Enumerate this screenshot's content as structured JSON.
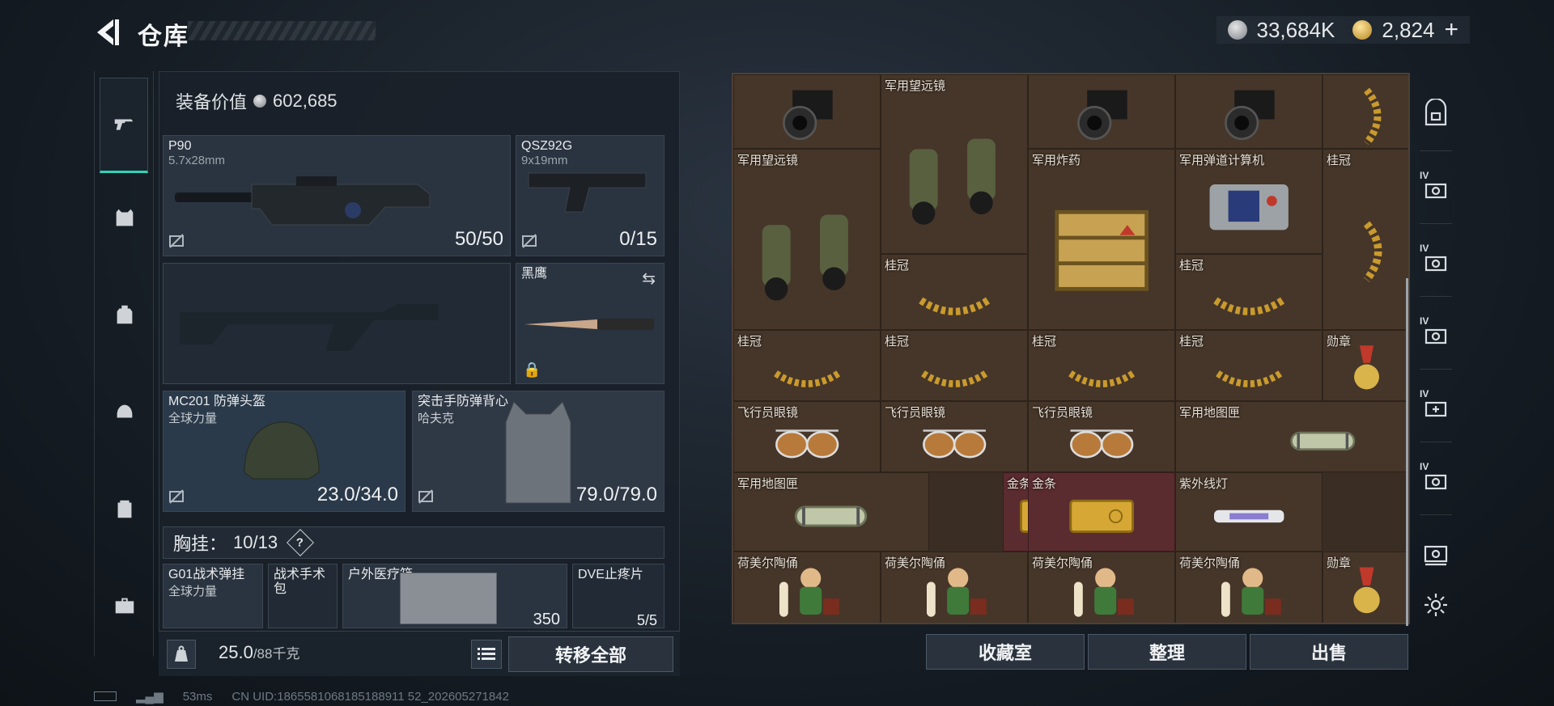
{
  "header": {
    "title": "仓库",
    "currency_silver": "33,684K",
    "currency_gold": "2,824",
    "add_label": "+"
  },
  "equipment": {
    "value_label": "装备价值",
    "value": "602,685",
    "primary": {
      "name": "P90",
      "caliber": "5.7x28mm",
      "ammo": "50/50"
    },
    "sidearm": {
      "name": "QSZ92G",
      "caliber": "9x19mm",
      "ammo": "0/15"
    },
    "knife": {
      "name": "黑鹰"
    },
    "helmet": {
      "name": "MC201 防弹头盔",
      "brand": "全球力量",
      "durability": "23.0/34.0"
    },
    "armor": {
      "name": "突击手防弹背心",
      "brand": "哈夫克",
      "durability": "79.0/79.0"
    },
    "chest_rig": {
      "label": "胸挂：",
      "capacity": "10/13",
      "help": "?"
    },
    "rig_items": [
      {
        "name": "G01战术弹挂",
        "brand": "全球力量"
      },
      {
        "name": "战术手术包"
      },
      {
        "name": "户外医疗箱",
        "value": "350"
      },
      {
        "name": "DVE止疼片",
        "value": "5/5"
      }
    ]
  },
  "bottom": {
    "weight": "25.0",
    "weight_max": "/88千克",
    "transfer_all": "转移全部"
  },
  "stash": {
    "items": [
      {
        "label": "",
        "type": "camera"
      },
      {
        "label": "军用望远镜",
        "type": "binoculars"
      },
      {
        "label": "",
        "type": "camera"
      },
      {
        "label": "",
        "type": "camera"
      },
      {
        "label": "",
        "type": "laurel-v"
      },
      {
        "label": "军用望远镜",
        "type": "binoculars"
      },
      {
        "label": "军用炸药",
        "type": "explosive"
      },
      {
        "label": "军用弹道计算机",
        "type": "computer"
      },
      {
        "label": "桂冠",
        "type": "laurel-v"
      },
      {
        "label": "桂冠",
        "type": "laurel"
      },
      {
        "label": "桂冠",
        "type": "laurel"
      },
      {
        "label": "桂冠",
        "type": "laurel"
      },
      {
        "label": "桂冠",
        "type": "laurel"
      },
      {
        "label": "桂冠",
        "type": "laurel"
      },
      {
        "label": "桂冠",
        "type": "laurel"
      },
      {
        "label": "勋章",
        "type": "medal"
      },
      {
        "label": "飞行员眼镜",
        "type": "glasses"
      },
      {
        "label": "飞行员眼镜",
        "type": "glasses"
      },
      {
        "label": "飞行员眼镜",
        "type": "glasses"
      },
      {
        "label": "军用地图匣",
        "type": "tube"
      },
      {
        "label": "军用地图匣",
        "type": "tube"
      },
      {
        "label": "金条",
        "type": "gold"
      },
      {
        "label": "金条",
        "type": "gold"
      },
      {
        "label": "紫外线灯",
        "type": "uvlamp"
      },
      {
        "label": "荷美尔陶俑",
        "type": "figurine"
      },
      {
        "label": "荷美尔陶俑",
        "type": "figurine"
      },
      {
        "label": "荷美尔陶俑",
        "type": "figurine"
      },
      {
        "label": "荷美尔陶俑",
        "type": "figurine"
      },
      {
        "label": "勋章",
        "type": "medal"
      }
    ],
    "buttons": {
      "collection": "收藏室",
      "sort": "整理",
      "sell": "出售"
    }
  },
  "right_rail": {
    "labels": [
      "IV",
      "IV",
      "IV",
      "IV",
      "IV"
    ]
  },
  "footer": {
    "ping": "53ms",
    "uid": "CN UID:1865581068185188911 52_202605271842"
  },
  "icons": {
    "left_rail": [
      "pistol-icon",
      "armor-icon",
      "backpack-icon",
      "helmet-icon",
      "clipboard-icon",
      "briefcase-icon"
    ],
    "right_rail": [
      "safe-icon",
      "case-icon",
      "case-icon",
      "case-icon",
      "case-add-icon",
      "case-icon",
      "case-active-icon",
      "settings-icon"
    ]
  },
  "colors": {
    "accent": "#2fd3b8",
    "stash_bg": "#3a2d24",
    "highlight_cell": "#5a2b2f"
  }
}
